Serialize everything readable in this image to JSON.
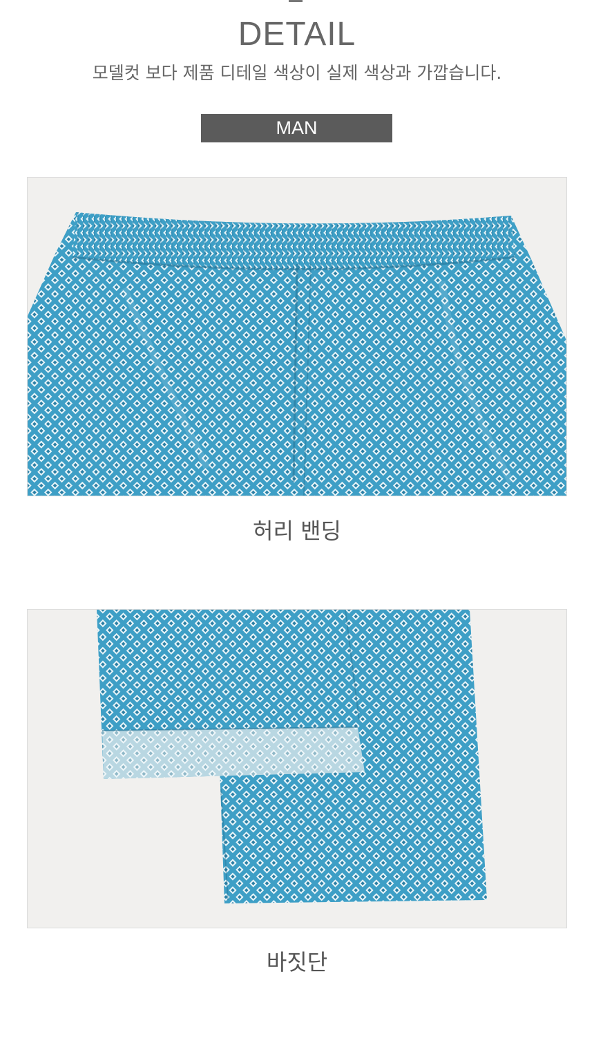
{
  "header": {
    "title": "DETAIL",
    "subtitle": "모델컷 보다 제품 디테일 색상이 실제 색상과 가깝습니다."
  },
  "badge": {
    "label": "MAN"
  },
  "details": [
    {
      "caption": "허리 밴딩"
    },
    {
      "caption": "바짓단"
    }
  ],
  "colors": {
    "fabric": "#3e9fc6",
    "fabric_dark": "#2a7fa5",
    "fabric_light": "#cfe6ef",
    "background": "#f1f0ee",
    "badge": "#5b5b5b"
  }
}
